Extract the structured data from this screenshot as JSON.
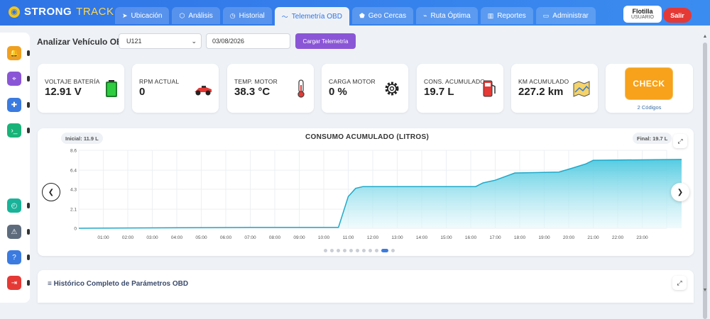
{
  "brand": {
    "name_a": "STRONG",
    "name_b": "TRACK"
  },
  "tabs": [
    {
      "label": "Ubicación",
      "icon": "➤"
    },
    {
      "label": "Análisis",
      "icon": "⬡"
    },
    {
      "label": "Historial",
      "icon": "◷"
    },
    {
      "label": "Telemetría OBD",
      "icon": "〜"
    },
    {
      "label": "Geo Cercas",
      "icon": "⬟"
    },
    {
      "label": "Ruta Óptima",
      "icon": "⌁"
    },
    {
      "label": "Reportes",
      "icon": "▥"
    },
    {
      "label": "Administrar",
      "icon": "▭"
    }
  ],
  "user": {
    "name": "Flotilla",
    "role": "USUARIO",
    "logout": "Salir"
  },
  "toolbar": {
    "label": "Analizar Vehículo OBD:",
    "vehicle": "U121",
    "date": "03/08/2026",
    "load": "Cargar Telemetría"
  },
  "cards": [
    {
      "label": "VOLTAJE BATERÍA",
      "value": "12.91 V",
      "icon": "battery-icon",
      "color": "#2ecc40"
    },
    {
      "label": "RPM ACTUAL",
      "value": "0",
      "icon": "race-car-icon",
      "color": "#e53935"
    },
    {
      "label": "TEMP. MOTOR",
      "value": "38.3 °C",
      "icon": "thermometer-icon",
      "color": "#e53935"
    },
    {
      "label": "CARGA MOTOR",
      "value": "0 %",
      "icon": "gear-icon",
      "color": "#333333"
    },
    {
      "label": "CONS. ACUMULADO",
      "value": "19.7 L",
      "icon": "fuel-pump-icon",
      "color": "#e53935"
    },
    {
      "label": "KM ACUMULADO",
      "value": "227.2 km",
      "icon": "map-icon",
      "color": "#f0b429"
    }
  ],
  "check": {
    "label": "CHECK",
    "codes": "2 Códigos"
  },
  "chart_header": {
    "initial": "Inicial: 11.9 L",
    "final": "Final: 19.7 L"
  },
  "chart_data": {
    "type": "area",
    "title": "CONSUMO ACUMULADO (LITROS)",
    "xlabel": "",
    "ylabel": "",
    "x": [
      "01:00",
      "02:00",
      "03:00",
      "04:00",
      "05:00",
      "06:00",
      "07:00",
      "08:00",
      "09:00",
      "10:00",
      "11:00",
      "12:00",
      "13:00",
      "14:00",
      "15:00",
      "16:00",
      "17:00",
      "18:00",
      "19:00",
      "20:00",
      "21:00",
      "22:00",
      "23:00"
    ],
    "yticks": [
      "0",
      "2.1",
      "4.3",
      "6.4",
      "8.6"
    ],
    "ylim": [
      0,
      8.6
    ],
    "xlim": [
      0,
      24
    ],
    "series": [
      {
        "points": [
          [
            0,
            0
          ],
          [
            7,
            0.1
          ],
          [
            10.6,
            0.1
          ],
          [
            11,
            3.5
          ],
          [
            11.3,
            4.4
          ],
          [
            11.6,
            4.6
          ],
          [
            16.2,
            4.6
          ],
          [
            16.5,
            5.0
          ],
          [
            17.0,
            5.3
          ],
          [
            17.8,
            6.1
          ],
          [
            19.6,
            6.2
          ],
          [
            20.1,
            6.6
          ],
          [
            20.7,
            7.1
          ],
          [
            21.0,
            7.5
          ],
          [
            24.8,
            7.6
          ]
        ]
      }
    ],
    "colors": {
      "line": "#1fa9c9",
      "fill_top": "#4cc9e0",
      "fill_bottom": "#e6f8fb"
    },
    "grid": true
  },
  "pager": {
    "count": 11,
    "active": 9
  },
  "history": {
    "title": "Histórico Completo de Parámetros OBD"
  },
  "sidebar": [
    {
      "icon": "bell-icon",
      "color": "#f0a020",
      "glyph": "🔔"
    },
    {
      "icon": "location-icon",
      "color": "#8a56d6",
      "glyph": "⌖"
    },
    {
      "icon": "add-user-icon",
      "color": "#3b7be0",
      "glyph": "✚"
    },
    {
      "icon": "terminal-icon",
      "color": "#19b37a",
      "glyph": "›_"
    },
    {
      "icon": "timer-icon",
      "color": "#19b39a",
      "glyph": "◴"
    },
    {
      "icon": "warning-icon",
      "color": "#5d6b7d",
      "glyph": "⚠"
    },
    {
      "icon": "help-icon",
      "color": "#3b7be0",
      "glyph": "?"
    },
    {
      "icon": "exit-icon",
      "color": "#e53935",
      "glyph": "⇥"
    }
  ]
}
